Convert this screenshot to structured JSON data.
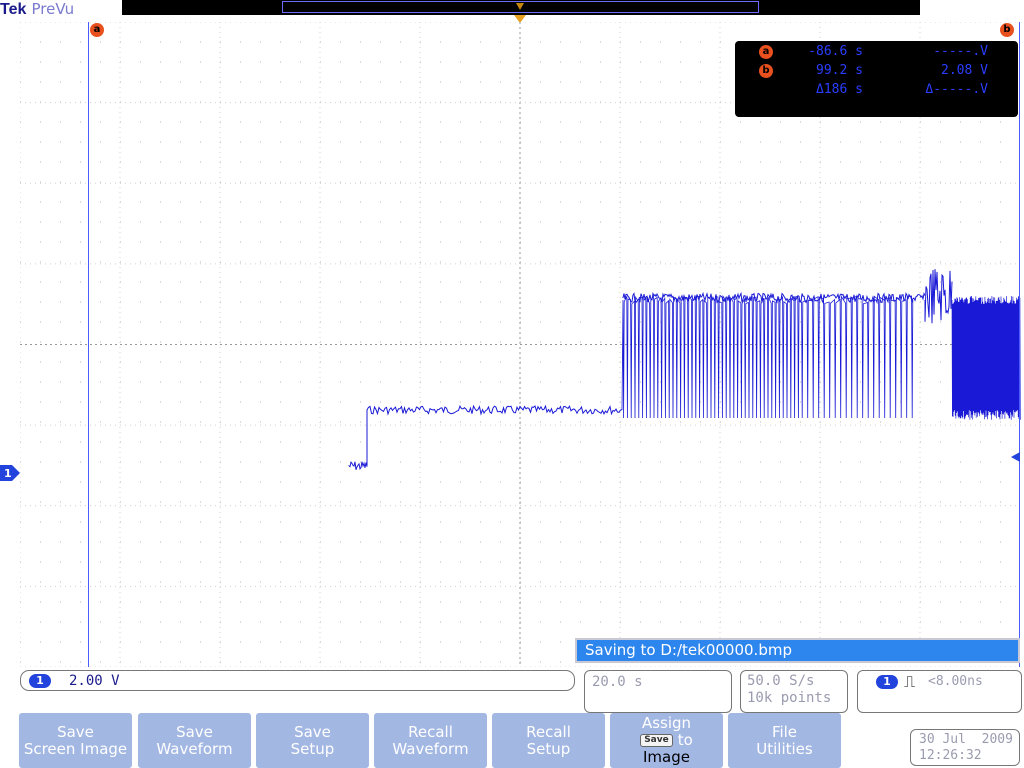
{
  "header": {
    "brand": "Tek",
    "mode": "PreVu"
  },
  "cursors": {
    "a_label": "a",
    "b_label": "b",
    "readout": {
      "a_time": "-86.6 s",
      "a_volt": "-----.V",
      "b_time": "99.2 s",
      "b_volt": "2.08 V",
      "delta_time": "Δ186 s",
      "delta_volt": "Δ-----.V"
    }
  },
  "status": {
    "saving": "Saving to D:/tek00000.bmp"
  },
  "channel": {
    "number": "1",
    "scale": "2.00 V"
  },
  "timebase": {
    "scale": "20.0 s"
  },
  "acquisition": {
    "rate": "50.0 S/s",
    "points": "10k points"
  },
  "trigger": {
    "channel": "1",
    "symbol": "⎍",
    "level": "<8.00ns"
  },
  "softkeys": [
    {
      "line1": "Save",
      "line2": "Screen Image"
    },
    {
      "line1": "Save",
      "line2": "Waveform"
    },
    {
      "line1": "Save",
      "line2": "Setup"
    },
    {
      "line1": "Recall",
      "line2": "Waveform"
    },
    {
      "line1": "Recall",
      "line2": "Setup"
    },
    {
      "line1": "Assign",
      "badge": "Save",
      "line2": "to",
      "line3": "Image"
    },
    {
      "line1": "File",
      "line2": "Utilities"
    }
  ],
  "datetime": {
    "date": "30 Jul  2009",
    "time": "12:26:32"
  },
  "colors": {
    "trace": "#1a1ad6",
    "accent": "#2d85ee",
    "softkey": "#a3b7e3",
    "cursor_badge": "#e8501e",
    "trigger_marker": "#e8a020"
  }
}
